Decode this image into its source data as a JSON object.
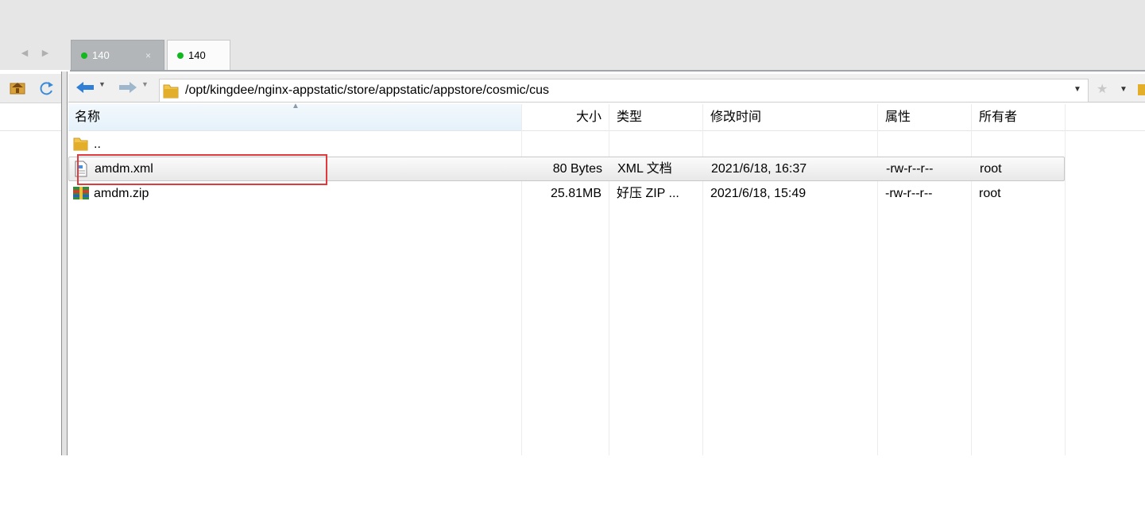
{
  "tabs": [
    {
      "label": "140",
      "close": "×",
      "status_color": "#12b81e"
    },
    {
      "label": "140",
      "status_color": "#12b81e"
    }
  ],
  "address_bar": {
    "path": "/opt/kingdee/nginx-appstatic/store/appstatic/appstore/cosmic/cus"
  },
  "columns": {
    "name": "名称",
    "size": "大小",
    "type": "类型",
    "modified": "修改时间",
    "attributes": "属性",
    "owner": "所有者"
  },
  "files": [
    {
      "name": "..",
      "size": "",
      "type": "",
      "modified": "",
      "attributes": "",
      "owner": "",
      "icon": "folder-icon"
    },
    {
      "name": "amdm.xml",
      "size": "80 Bytes",
      "type": "XML 文档",
      "modified": "2021/6/18, 16:37",
      "attributes": "-rw-r--r--",
      "owner": "root",
      "icon": "xml-file-icon"
    },
    {
      "name": "amdm.zip",
      "size": "25.81MB",
      "type": "好压 ZIP ...",
      "modified": "2021/6/18, 15:49",
      "attributes": "-rw-r--r--",
      "owner": "root",
      "icon": "zip-archive-icon"
    }
  ],
  "colors": {
    "highlight": "#e0393e",
    "status_online": "#12b81e"
  }
}
